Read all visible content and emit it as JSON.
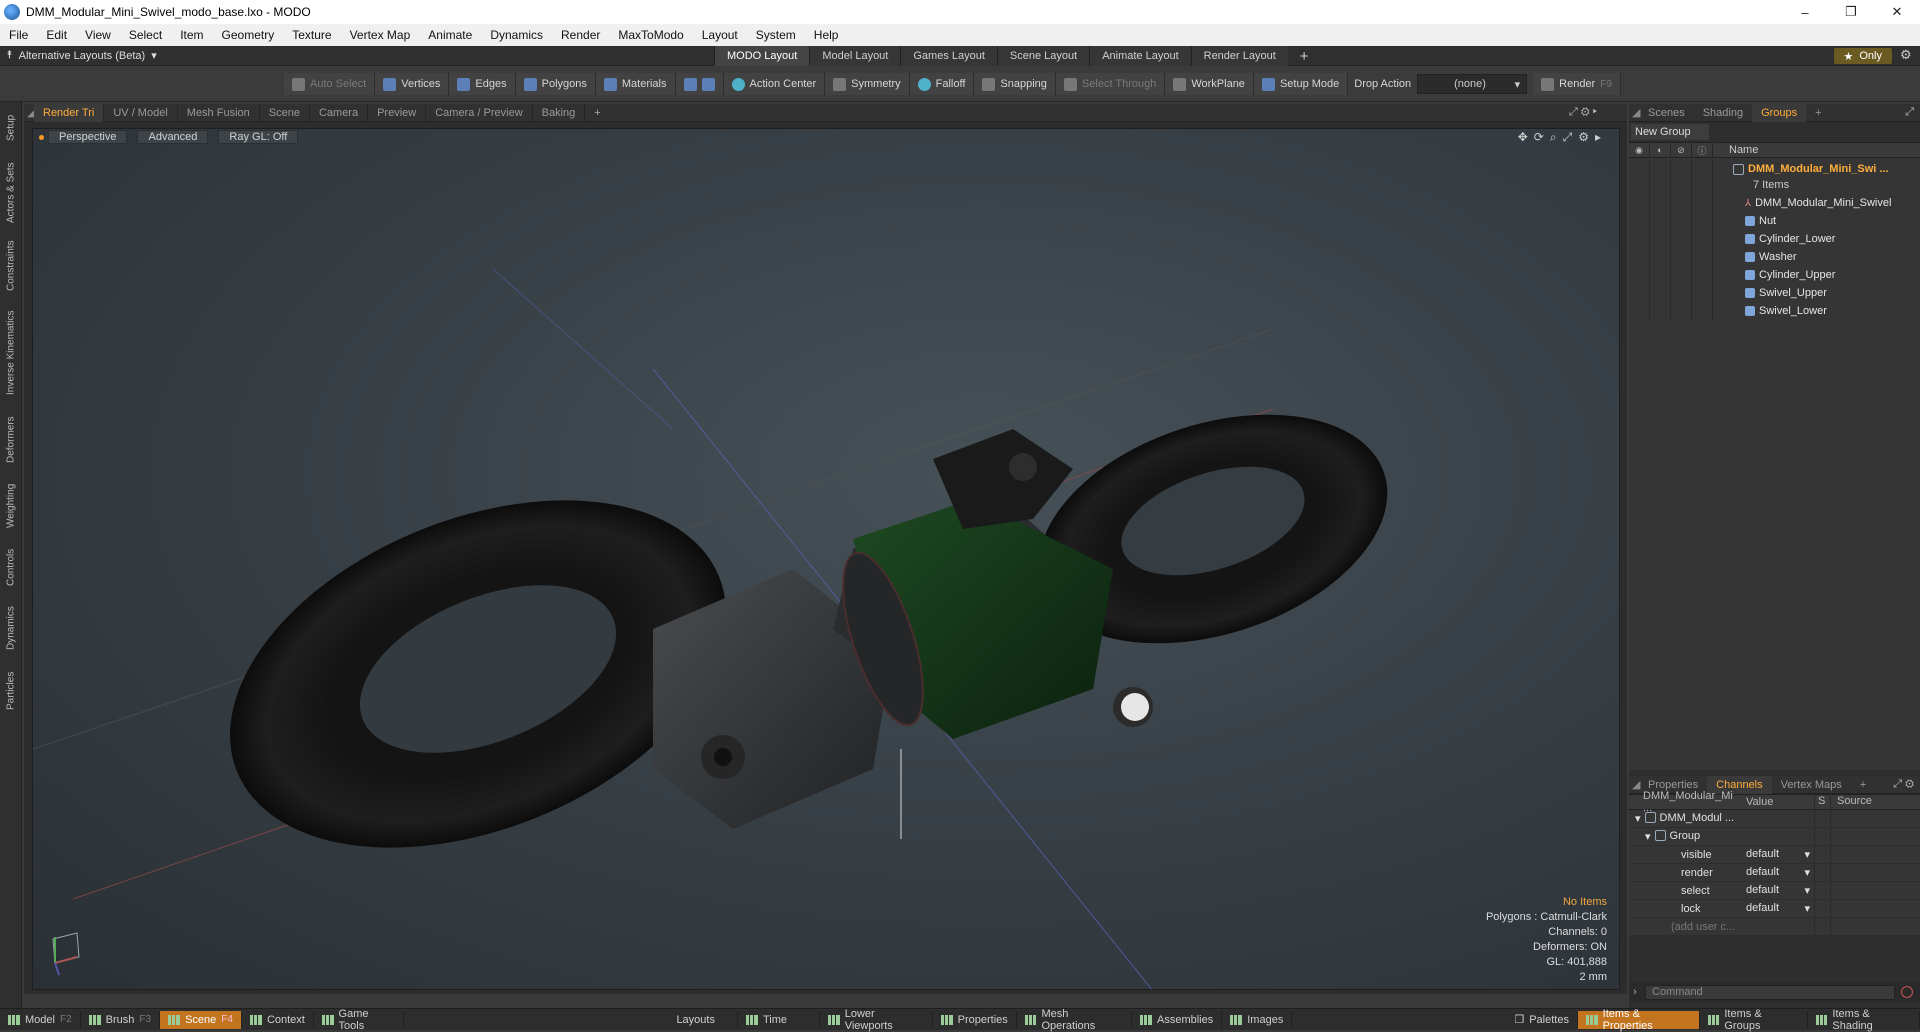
{
  "window": {
    "title": "DMM_Modular_Mini_Swivel_modo_base.lxo - MODO",
    "min": "–",
    "max": "❐",
    "close": "✕"
  },
  "menu": [
    "File",
    "Edit",
    "View",
    "Select",
    "Item",
    "Geometry",
    "Texture",
    "Vertex Map",
    "Animate",
    "Dynamics",
    "Render",
    "MaxToModo",
    "Layout",
    "System",
    "Help"
  ],
  "layoutbar": {
    "alt_layouts": "Alternative Layouts (Beta)",
    "tabs": [
      "MODO Layout",
      "Model Layout",
      "Games Layout",
      "Scene Layout",
      "Animate Layout",
      "Render Layout"
    ],
    "active_tab": "MODO Layout",
    "only": "Only"
  },
  "toolbar": {
    "auto_select": "Auto Select",
    "vertices": "Vertices",
    "edges": "Edges",
    "polygons": "Polygons",
    "materials": "Materials",
    "action_center": "Action Center",
    "symmetry": "Symmetry",
    "falloff": "Falloff",
    "snapping": "Snapping",
    "select_through": "Select Through",
    "workplane": "WorkPlane",
    "setup_mode": "Setup Mode",
    "drop_action": "Drop Action",
    "drop_value": "(none)",
    "render": "Render",
    "render_key": "F9"
  },
  "leftstrip": [
    "Setup",
    "Actors & Sets",
    "Constraints",
    "Inverse Kinematics",
    "Deformers",
    "Weighting",
    "Controls",
    "Dynamics",
    "Particles"
  ],
  "viewport_tabs": [
    "Render Tri",
    "UV / Model",
    "Mesh Fusion",
    "Scene",
    "Camera",
    "Preview",
    "Camera / Preview",
    "Baking"
  ],
  "viewport": {
    "perspective": "Perspective",
    "advanced": "Advanced",
    "raygl": "Ray GL: Off"
  },
  "stats": {
    "items": "No Items",
    "polygons": "Polygons : Catmull-Clark",
    "channels": "Channels: 0",
    "deformers": "Deformers: ON",
    "gl": "GL: 401,888",
    "scale": "2 mm"
  },
  "scene_tabs": [
    "Scenes",
    "Shading",
    "Groups"
  ],
  "groups": {
    "new_group": "New Group",
    "name_col": "Name",
    "root": "DMM_Modular_Mini_Swi ...",
    "count": "7 Items",
    "items": [
      "DMM_Modular_Mini_Swivel",
      "Nut",
      "Washer",
      "Cylinder_Lower",
      "Cylinder_Upper",
      "Swivel_Upper",
      "Swivel_Lower"
    ]
  },
  "prop_tabs": [
    "Properties",
    "Channels",
    "Vertex Maps"
  ],
  "channels": {
    "col_name": "DMM_Modular_Mi ...",
    "col_value": "Value",
    "col_s": "S",
    "col_source": "Source",
    "root": "DMM_Modul ...",
    "group": "Group",
    "rows": [
      {
        "name": "visible",
        "value": "default"
      },
      {
        "name": "render",
        "value": "default"
      },
      {
        "name": "select",
        "value": "default"
      },
      {
        "name": "lock",
        "value": "default"
      }
    ],
    "add_user": "(add user c..."
  },
  "command": "Command",
  "statusbar": {
    "model": "Model",
    "model_key": "F2",
    "brush": "Brush",
    "brush_key": "F3",
    "scene": "Scene",
    "scene_key": "F4",
    "context": "Context",
    "game_tools": "Game Tools",
    "layouts": "Layouts",
    "time": "Time",
    "lower_viewports": "Lower Viewports",
    "properties": "Properties",
    "mesh_ops": "Mesh Operations",
    "assemblies": "Assemblies",
    "images": "Images",
    "palettes": "Palettes",
    "items_props": "Items & Properties",
    "items_groups": "Items & Groups",
    "items_shading": "Items & Shading"
  },
  "colors": {
    "accent": "#ffae3c",
    "active_bar": "#c3741f",
    "body": "#0f2a14"
  }
}
